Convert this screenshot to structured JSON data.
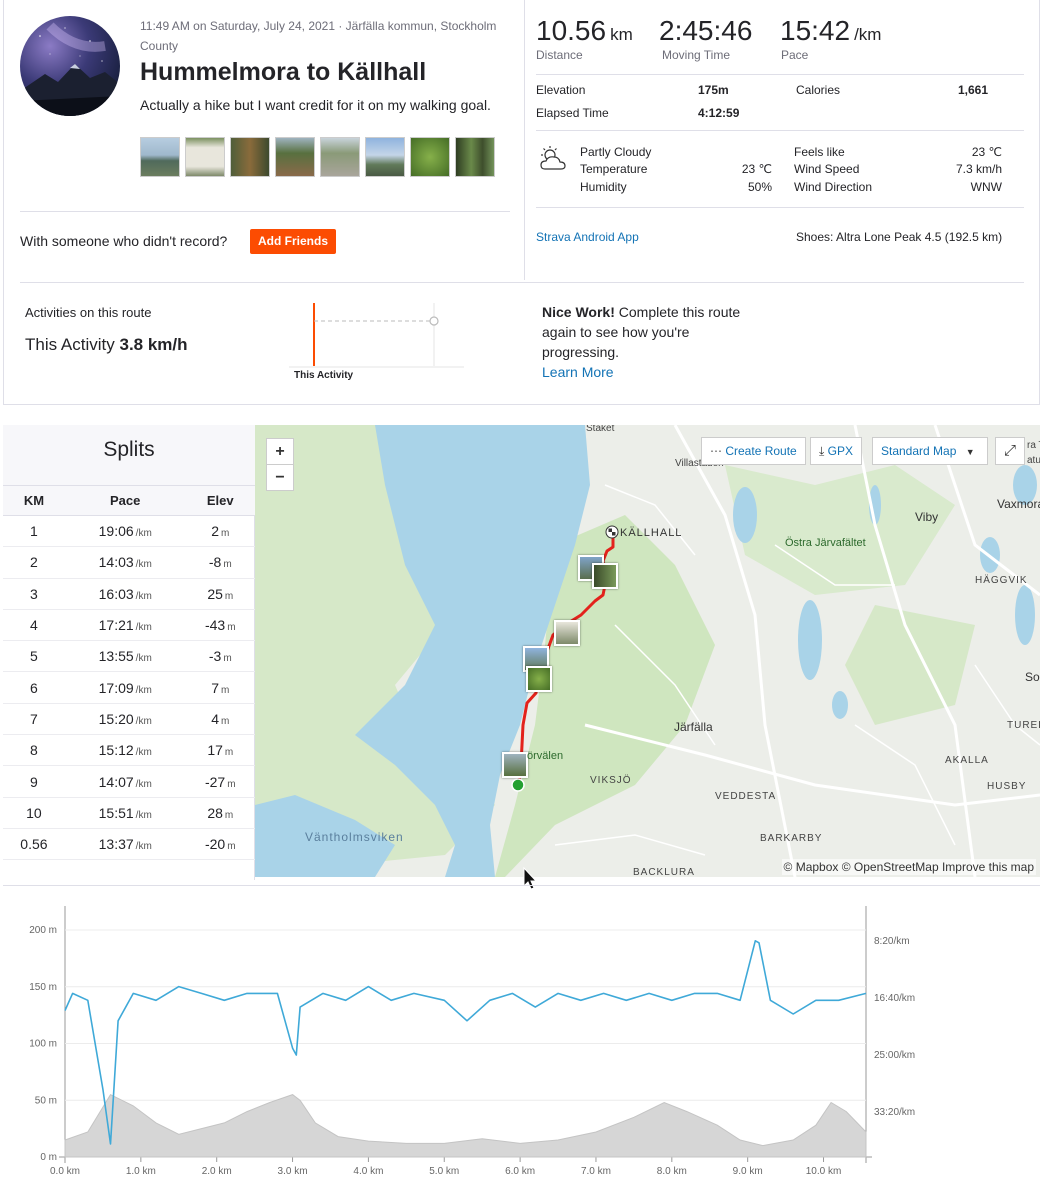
{
  "activity": {
    "meta": "11:49 AM on Saturday, July 24, 2021 · Järfälla kommun, Stockholm County",
    "title": "Hummelmora to Källhall",
    "description": "Actually a hike but I want credit for it on my walking goal.",
    "with_someone": "With someone who didn't record?",
    "add_friends": "Add Friends"
  },
  "stats": {
    "distance_value": "10.56",
    "distance_unit": "km",
    "distance_label": "Distance",
    "moving_time_value": "2:45:46",
    "moving_time_label": "Moving Time",
    "pace_value": "15:42",
    "pace_unit": "/km",
    "pace_label": "Pace",
    "elevation_label": "Elevation",
    "elevation_value": "175m",
    "calories_label": "Calories",
    "calories_value": "1,661",
    "elapsed_label": "Elapsed Time",
    "elapsed_value": "4:12:59"
  },
  "weather": {
    "icon": "partly-cloudy-icon",
    "condition": "Partly Cloudy",
    "temperature_label": "Temperature",
    "temperature_value": "23 ℃",
    "humidity_label": "Humidity",
    "humidity_value": "50%",
    "feels_like_label": "Feels like",
    "feels_like_value": "23 ℃",
    "wind_speed_label": "Wind Speed",
    "wind_speed_value": "7.3 km/h",
    "wind_direction_label": "Wind Direction",
    "wind_direction_value": "WNW"
  },
  "device": {
    "app": "Strava Android App",
    "shoes": "Shoes: Altra Lone Peak 4.5 (192.5 km)"
  },
  "route": {
    "header": "Activities on this route",
    "this_activity_prefix": "This Activity",
    "this_activity_speed": "3.8 km/h",
    "chart_label": "This Activity",
    "nice_work_bold": "Nice Work!",
    "nice_work_text": "Complete this route again to see how you're progressing.",
    "learn_more": "Learn More"
  },
  "splits": {
    "title": "Splits",
    "headers": [
      "KM",
      "Pace",
      "Elev"
    ],
    "pace_unit": "/km",
    "elev_unit": "m",
    "rows": [
      {
        "km": "1",
        "pace": "19:06",
        "elev": "2"
      },
      {
        "km": "2",
        "pace": "14:03",
        "elev": "-8"
      },
      {
        "km": "3",
        "pace": "16:03",
        "elev": "25"
      },
      {
        "km": "4",
        "pace": "17:21",
        "elev": "-43"
      },
      {
        "km": "5",
        "pace": "13:55",
        "elev": "-3"
      },
      {
        "km": "6",
        "pace": "17:09",
        "elev": "7"
      },
      {
        "km": "7",
        "pace": "15:20",
        "elev": "4"
      },
      {
        "km": "8",
        "pace": "15:12",
        "elev": "17"
      },
      {
        "km": "9",
        "pace": "14:07",
        "elev": "-27"
      },
      {
        "km": "10",
        "pace": "15:51",
        "elev": "28"
      },
      {
        "km": "0.56",
        "pace": "13:37",
        "elev": "-20"
      }
    ]
  },
  "map": {
    "zoom_in": "+",
    "zoom_out": "−",
    "create_route": "Create Route",
    "gpx": "GPX",
    "map_type": "Standard Map",
    "attribution": "© Mapbox © OpenStreetMap Improve this map",
    "labels": {
      "staket": "Staket",
      "villastaden": "Villastaden",
      "kallhall": "KÄLLHALL",
      "viby": "Viby",
      "vaxmora": "Vaxmora",
      "ostra": "Östra Järvafältet",
      "haggvik": "HÄGGVIK",
      "jarfalla": "Järfälla",
      "solla": "Soll",
      "tureberg": "TUREBERG",
      "akalla": "AKALLA",
      "husby": "HUSBY",
      "orvalen": "örvälen",
      "viksjo": "VIKSJÖ",
      "veddesta": "VEDDESTA",
      "barkarby": "BARKARBY",
      "vantholm": "Väntholmsviken",
      "backlura": "BACKLURA",
      "partial": "ra T",
      "partial2": "atu"
    }
  },
  "elevation_chart": {
    "y_left_ticks": [
      "200 m",
      "150 m",
      "100 m",
      "50 m",
      "0 m"
    ],
    "y_right_ticks": [
      "8:20/km",
      "16:40/km",
      "25:00/km",
      "33:20/km"
    ],
    "x_ticks": [
      "0.0 km",
      "1.0 km",
      "2.0 km",
      "3.0 km",
      "4.0 km",
      "5.0 km",
      "6.0 km",
      "7.0 km",
      "8.0 km",
      "9.0 km",
      "10.0 km"
    ]
  },
  "chart_data": {
    "type": "area",
    "x_unit": "km",
    "xlim": [
      0,
      10.56
    ],
    "ylim": [
      0,
      200
    ],
    "elevation_m": [
      [
        0,
        15
      ],
      [
        0.3,
        22
      ],
      [
        0.6,
        55
      ],
      [
        0.9,
        45
      ],
      [
        1.2,
        30
      ],
      [
        1.5,
        20
      ],
      [
        1.8,
        25
      ],
      [
        2.1,
        30
      ],
      [
        2.4,
        40
      ],
      [
        2.7,
        48
      ],
      [
        3.0,
        55
      ],
      [
        3.1,
        50
      ],
      [
        3.3,
        30
      ],
      [
        3.6,
        18
      ],
      [
        4.0,
        14
      ],
      [
        4.5,
        12
      ],
      [
        5.0,
        12
      ],
      [
        5.5,
        16
      ],
      [
        6.0,
        12
      ],
      [
        6.5,
        15
      ],
      [
        7.0,
        22
      ],
      [
        7.5,
        35
      ],
      [
        7.9,
        48
      ],
      [
        8.2,
        40
      ],
      [
        8.6,
        28
      ],
      [
        8.9,
        15
      ],
      [
        9.2,
        10
      ],
      [
        9.6,
        15
      ],
      [
        9.9,
        28
      ],
      [
        10.1,
        48
      ],
      [
        10.3,
        40
      ],
      [
        10.56,
        22
      ]
    ],
    "pace_min_per_km": [
      [
        0,
        18.5
      ],
      [
        0.1,
        16
      ],
      [
        0.3,
        17
      ],
      [
        0.5,
        30
      ],
      [
        0.6,
        38
      ],
      [
        0.7,
        20
      ],
      [
        0.9,
        16
      ],
      [
        1.2,
        17
      ],
      [
        1.5,
        15
      ],
      [
        1.8,
        16
      ],
      [
        2.1,
        17
      ],
      [
        2.4,
        16
      ],
      [
        2.8,
        16
      ],
      [
        3.0,
        24
      ],
      [
        3.05,
        25
      ],
      [
        3.1,
        18
      ],
      [
        3.4,
        16
      ],
      [
        3.7,
        17
      ],
      [
        4.0,
        15
      ],
      [
        4.3,
        17
      ],
      [
        4.6,
        16
      ],
      [
        5.0,
        17
      ],
      [
        5.3,
        20
      ],
      [
        5.6,
        17
      ],
      [
        5.9,
        16
      ],
      [
        6.2,
        18
      ],
      [
        6.5,
        16
      ],
      [
        6.8,
        17
      ],
      [
        7.1,
        16
      ],
      [
        7.4,
        17
      ],
      [
        7.7,
        16
      ],
      [
        8.0,
        17
      ],
      [
        8.3,
        16
      ],
      [
        8.6,
        16
      ],
      [
        8.9,
        17
      ],
      [
        9.1,
        8.3
      ],
      [
        9.15,
        8.6
      ],
      [
        9.3,
        17
      ],
      [
        9.6,
        19
      ],
      [
        9.9,
        17
      ],
      [
        10.2,
        17
      ],
      [
        10.56,
        16
      ]
    ]
  }
}
